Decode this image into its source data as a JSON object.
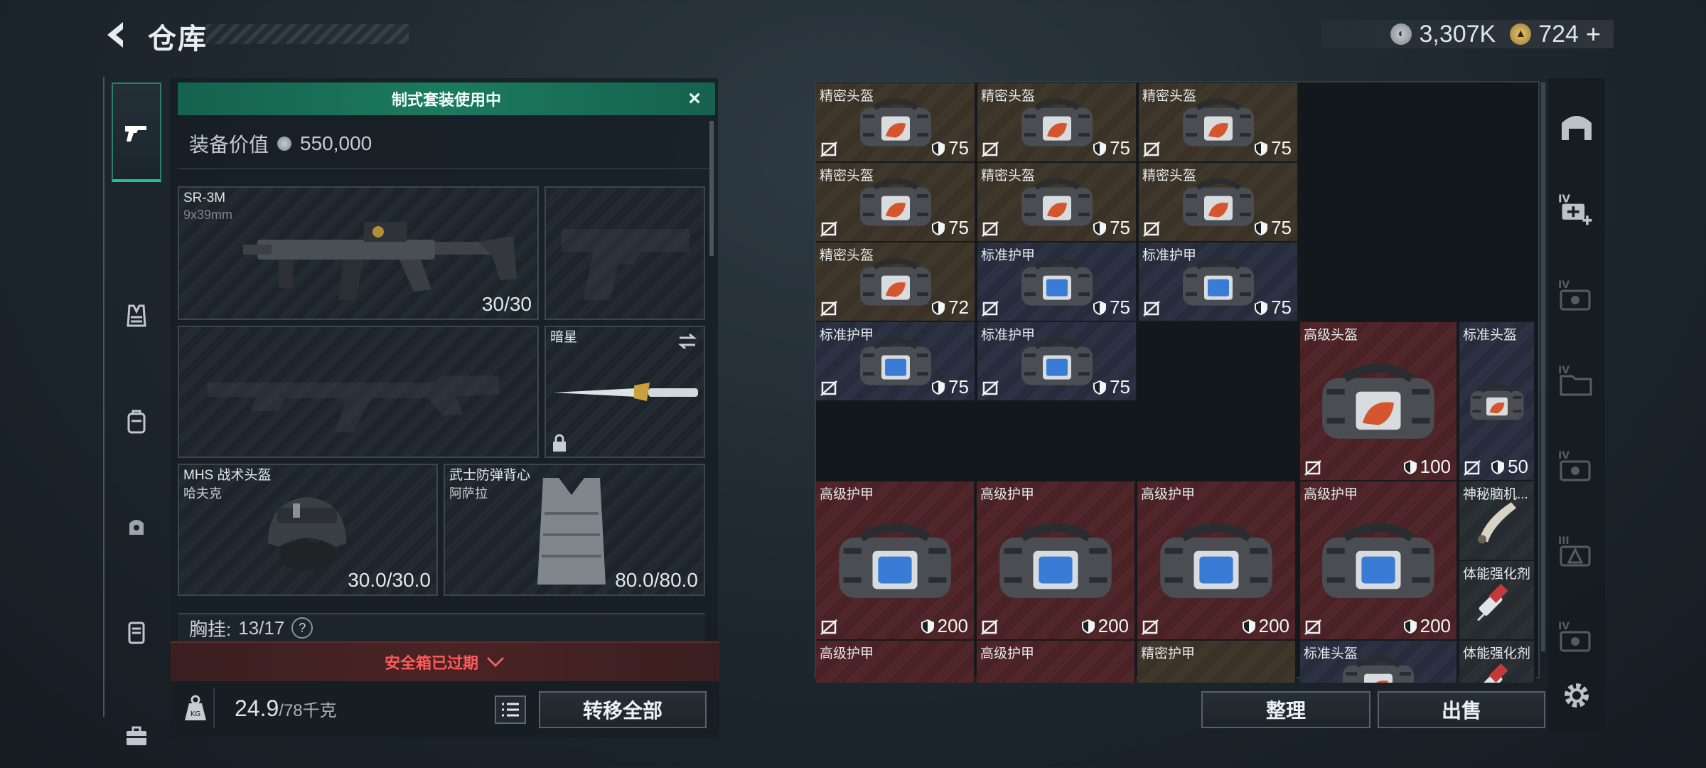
{
  "header": {
    "title": "仓库",
    "silver": "3,307K",
    "gold": "724",
    "gold_add": "+"
  },
  "kit": {
    "banner": "制式套装使用中",
    "value_label": "装备价值",
    "value": "550,000"
  },
  "slots": {
    "primary": {
      "name": "SR-3M",
      "ammo": "9x39mm",
      "count": "30/30"
    },
    "melee": {
      "name": "暗星"
    },
    "helmet": {
      "name": "MHS 战术头盔",
      "sub": "哈夫克",
      "count": "30.0/30.0"
    },
    "armor": {
      "name": "武士防弹背心",
      "sub": "阿萨拉",
      "count": "80.0/80.0"
    }
  },
  "chest_rig": {
    "label": "胸挂:",
    "value": "13/17",
    "help": "?"
  },
  "safe_box": {
    "label": "安全箱已过期"
  },
  "footer": {
    "weight": "24.9",
    "weight_max": "/78千克",
    "transfer_all": "转移全部",
    "sort": "整理",
    "sell": "出售"
  },
  "inventory": {
    "items": [
      {
        "name": "精密头盔",
        "dur": "75",
        "color": "brown",
        "kind": "helm"
      },
      {
        "name": "精密头盔",
        "dur": "75",
        "color": "brown",
        "kind": "helm"
      },
      {
        "name": "精密头盔",
        "dur": "75",
        "color": "brown",
        "kind": "helm"
      },
      {
        "name": "精密头盔",
        "dur": "75",
        "color": "brown",
        "kind": "helm"
      },
      {
        "name": "精密头盔",
        "dur": "75",
        "color": "brown",
        "kind": "helm"
      },
      {
        "name": "精密头盔",
        "dur": "75",
        "color": "brown",
        "kind": "helm"
      },
      {
        "name": "精密头盔",
        "dur": "72",
        "color": "brown",
        "kind": "helm"
      },
      {
        "name": "标准护甲",
        "dur": "75",
        "color": "blue",
        "kind": "armor"
      },
      {
        "name": "标准护甲",
        "dur": "75",
        "color": "blue",
        "kind": "armor"
      },
      {
        "name": "标准护甲",
        "dur": "75",
        "color": "blue",
        "kind": "armor"
      },
      {
        "name": "标准护甲",
        "dur": "75",
        "color": "blue",
        "kind": "armor"
      },
      {
        "name": "高级头盔",
        "dur": "100",
        "color": "red",
        "kind": "helm"
      },
      {
        "name": "标准头盔",
        "dur": "50",
        "color": "blue",
        "kind": "helm"
      },
      {
        "name": "高级护甲",
        "dur": "200",
        "color": "red",
        "kind": "armor"
      },
      {
        "name": "高级护甲",
        "dur": "200",
        "color": "red",
        "kind": "armor"
      },
      {
        "name": "高级护甲",
        "dur": "200",
        "color": "red",
        "kind": "armor"
      },
      {
        "name": "高级护甲",
        "dur": "200",
        "color": "red",
        "kind": "armor"
      },
      {
        "name": "神秘脑机...",
        "dur": "",
        "color": "grey",
        "kind": "horn"
      },
      {
        "name": "高级护甲",
        "dur": "",
        "color": "red",
        "kind": "armor"
      },
      {
        "name": "高级护甲",
        "dur": "",
        "color": "red",
        "kind": "armor"
      },
      {
        "name": "精密护甲",
        "dur": "",
        "color": "brown",
        "kind": "armor"
      },
      {
        "name": "体能强化剂",
        "dur": "",
        "color": "grey",
        "kind": "syringe"
      },
      {
        "name": "标准头盔",
        "dur": "",
        "color": "blue",
        "kind": "helm"
      },
      {
        "name": "体能强化剂",
        "dur": "",
        "color": "grey",
        "kind": "syringe"
      }
    ]
  },
  "side_tabs": {
    "tier_labels": [
      "IV",
      "IV",
      "IV",
      "III",
      "IV"
    ]
  },
  "colors": {
    "accent_green": "#1c7a5e",
    "warning_red": "#ff5a5a",
    "cell_brown": "#3a3226",
    "cell_blue": "#272c3d",
    "cell_red": "#4a2226"
  }
}
